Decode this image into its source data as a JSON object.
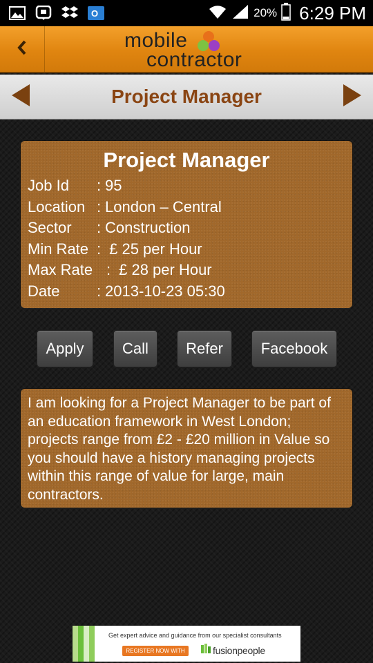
{
  "status_bar": {
    "battery_percent": "20%",
    "time": "6:29 PM",
    "left_icons": [
      "gallery-icon",
      "bbm-icon",
      "dropbox-icon",
      "outlook-icon"
    ]
  },
  "app_header": {
    "logo_line1": "mobile",
    "logo_line2": "contractor",
    "back_icon": "chevron-left-icon"
  },
  "title_bar": {
    "title": "Project Manager",
    "prev_icon": "arrow-left-icon",
    "next_icon": "arrow-right-icon"
  },
  "job": {
    "title": "Project Manager",
    "rows": [
      {
        "label": "Job Id",
        "sep": ":",
        "value": "95"
      },
      {
        "label": "Location",
        "sep": ":",
        "value": "London – Central"
      },
      {
        "label": "Sector",
        "sep": ":",
        "value": "Construction"
      },
      {
        "label": "Min Rate",
        "sep": ":",
        "value": " £ 25 per Hour"
      },
      {
        "label": "Max Rate",
        "sep": ":",
        "value": " £ 28 per Hour"
      },
      {
        "label": "Date",
        "sep": ":",
        "value": "2013-10-23 05:30"
      }
    ],
    "description": "I am looking for a Project Manager to be part of an education framework in West London; projects range from £2 - £20 million in Value so you should have a history managing projects within this range of value for large, main contractors."
  },
  "actions": {
    "apply": "Apply",
    "call": "Call",
    "refer": "Refer",
    "facebook": "Facebook"
  },
  "ad": {
    "headline": "Get expert advice and guidance from our specialist consultants",
    "cta": "REGISTER NOW WITH",
    "brand": "fusionpeople"
  },
  "colors": {
    "header_orange": "#e08510",
    "card_brown": "#a1682b",
    "title_brown": "#8a4513",
    "button_dark": "#4a4a4a"
  }
}
